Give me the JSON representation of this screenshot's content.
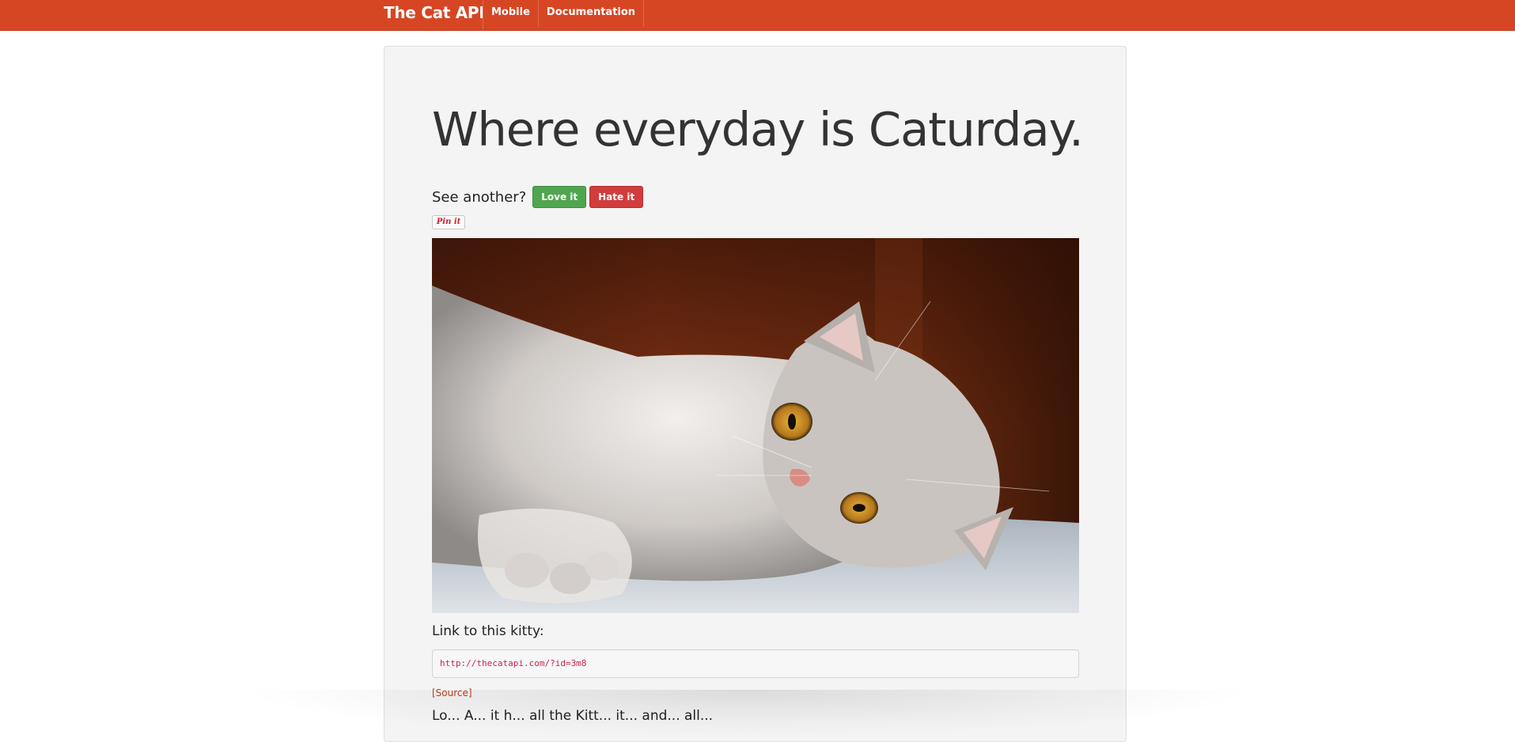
{
  "nav": {
    "brand": "The Cat API",
    "links": [
      "Mobile",
      "Documentation"
    ]
  },
  "hero": {
    "title": "Where everyday is Caturday.",
    "prompt": "See another?",
    "love_label": "Love it",
    "hate_label": "Hate it",
    "pin_label": "Pin it",
    "link_label": "Link to this kitty:",
    "link_value": "http://thecatapi.com/?id=3m8",
    "source_label": "[Source]",
    "partial_text": "Lo... A... it h... all the Kitt... it... and... all..."
  },
  "colors": {
    "navbar": "#d64623",
    "love": "#4fa64f",
    "hate": "#d23c3c",
    "link_text": "#c7254e"
  },
  "icons": {
    "pin_it": "pinterest-pin-it-icon"
  }
}
